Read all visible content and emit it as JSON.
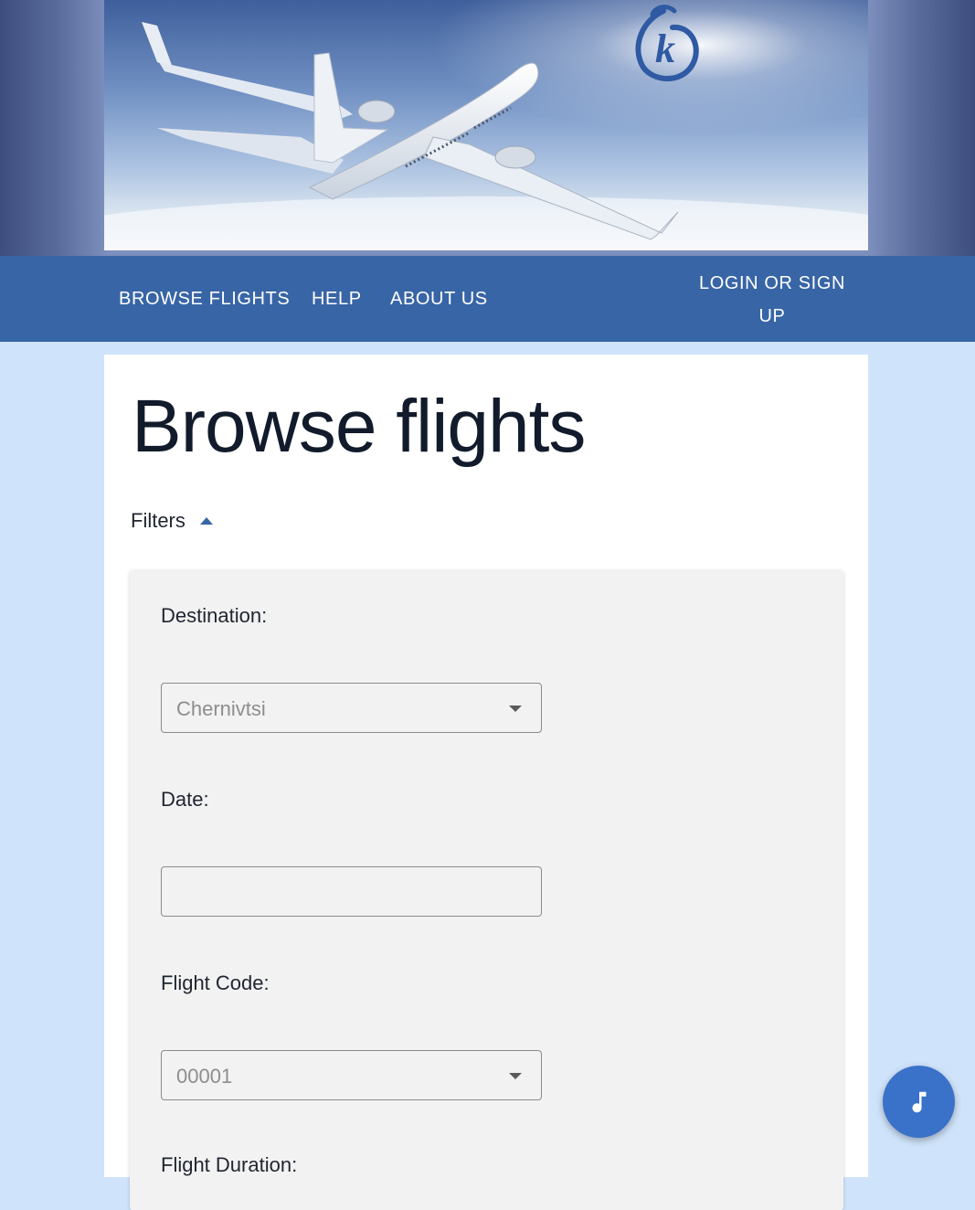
{
  "header": {
    "logo_letter": "k"
  },
  "nav": {
    "browse_flights": "BROWSE FLIGHTS",
    "help": "HELP",
    "about_us": "ABOUT US",
    "login_line1": "LOGIN OR SIGN",
    "login_line2": "UP"
  },
  "main": {
    "title": "Browse flights",
    "filters_label": "Filters"
  },
  "filters": {
    "destination_label": "Destination:",
    "destination_value": "Chernivtsi",
    "date_label": "Date:",
    "date_value": "",
    "flight_code_label": "Flight Code:",
    "flight_code_value": "00001",
    "flight_duration_label": "Flight Duration:"
  },
  "icons": {
    "fab": "music-note-icon",
    "filters_toggle": "caret-up-icon",
    "dropdown": "caret-down-icon"
  },
  "colors": {
    "navbar": "#3865a6",
    "page_background": "#cfe3fa",
    "fab": "#3a71c9",
    "panel": "#f2f2f2"
  }
}
